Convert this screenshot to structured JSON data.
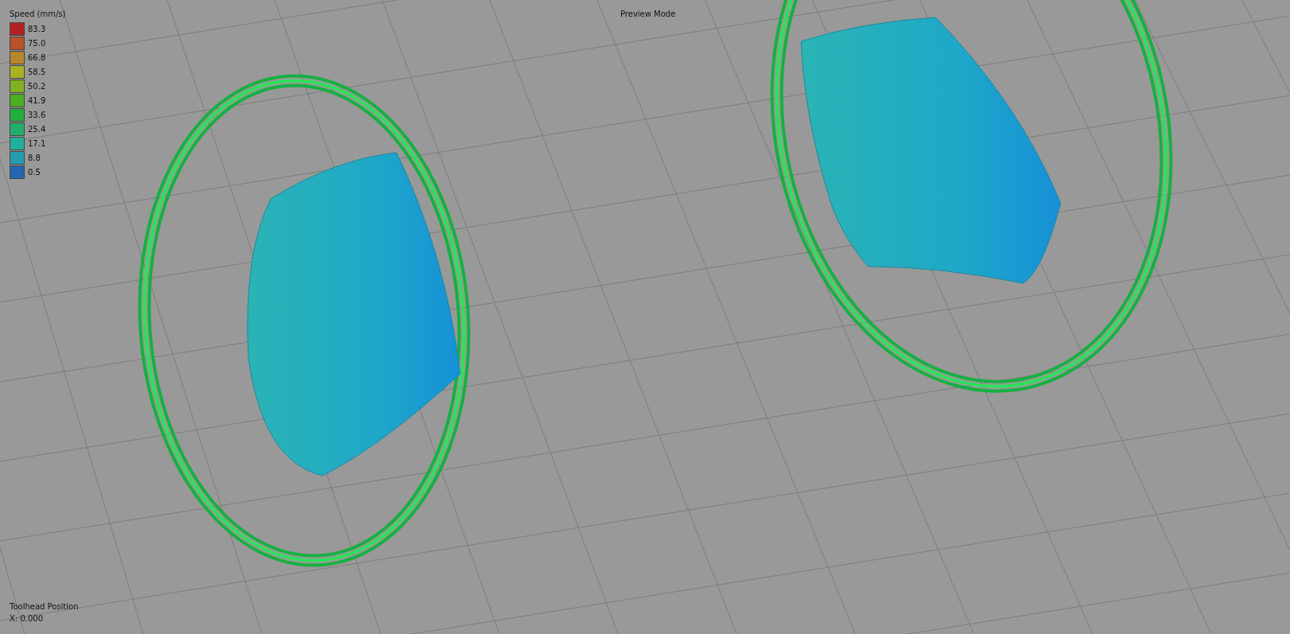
{
  "viewport": {
    "mode_label": "Preview Mode"
  },
  "legend": {
    "title": "Speed (mm/s)",
    "items": [
      {
        "value": "83.3",
        "color": "#b22222"
      },
      {
        "value": "75.0",
        "color": "#b8522a"
      },
      {
        "value": "66.8",
        "color": "#b8862a"
      },
      {
        "value": "58.5",
        "color": "#aab022"
      },
      {
        "value": "50.2",
        "color": "#82b022"
      },
      {
        "value": "41.9",
        "color": "#4cae22"
      },
      {
        "value": "33.6",
        "color": "#22ae3c"
      },
      {
        "value": "25.4",
        "color": "#22ae6a"
      },
      {
        "value": "17.1",
        "color": "#22b09a"
      },
      {
        "value": "8.8",
        "color": "#229eb0"
      },
      {
        "value": "0.5",
        "color": "#2266b0"
      }
    ]
  },
  "toolhead": {
    "title": "Toolhead Position",
    "reading": "X: 0.000"
  }
}
